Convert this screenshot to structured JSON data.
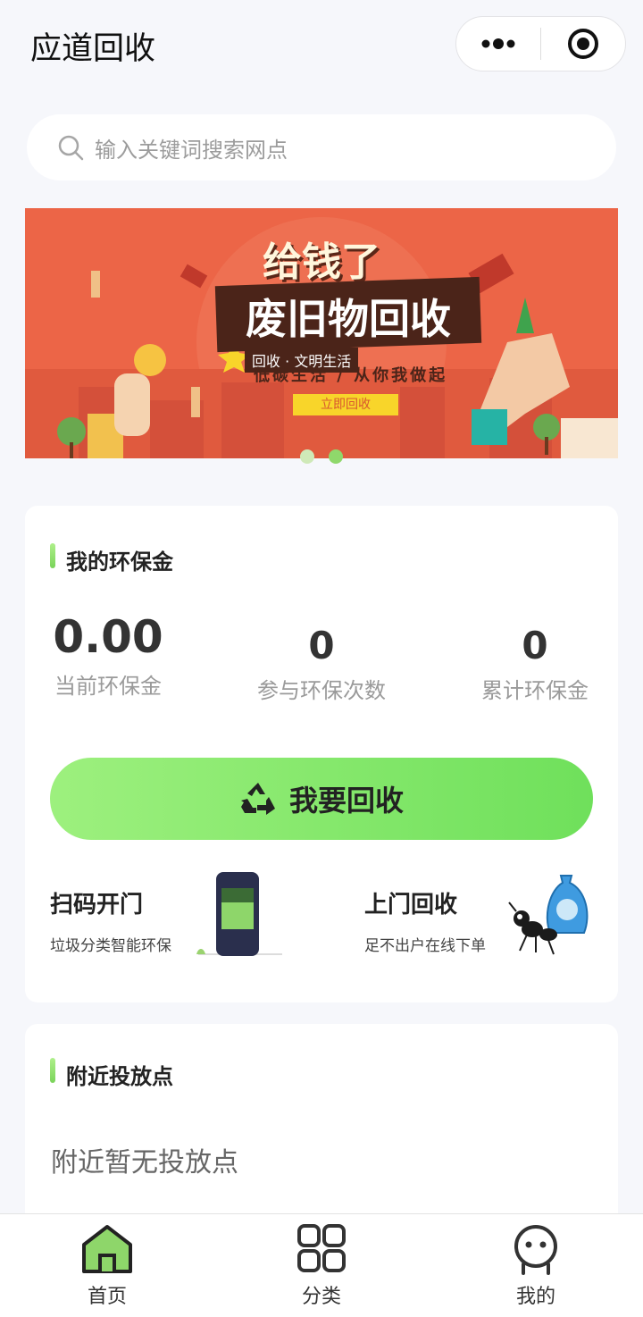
{
  "app": {
    "title": "应道回收"
  },
  "search": {
    "placeholder": "输入关键词搜索网点"
  },
  "banner": {
    "title_line1": "给钱了",
    "title_line2": "废旧物回收",
    "tag": "回收 · 文明生活",
    "subtitle": "低碳生活 / 从你我做起",
    "button": "立即回收",
    "slides": 2,
    "active_slide": 2
  },
  "wallet": {
    "title": "我的环保金",
    "stats": [
      {
        "value": "0.00",
        "label": "当前环保金"
      },
      {
        "value": "0",
        "label": "参与环保次数"
      },
      {
        "value": "0",
        "label": "累计环保金"
      }
    ],
    "recycle_button": "我要回收"
  },
  "services": [
    {
      "title": "扫码开门",
      "subtitle": "垃圾分类智能环保",
      "icon": "phone-scan-icon"
    },
    {
      "title": "上门回收",
      "subtitle": "足不出户在线下单",
      "icon": "ant-recycle-bag-icon"
    }
  ],
  "nearby": {
    "title": "附近投放点",
    "empty": "附近暂无投放点"
  },
  "tabbar": [
    {
      "label": "首页",
      "icon": "home-icon",
      "active": true
    },
    {
      "label": "分类",
      "icon": "grid-icon",
      "active": false
    },
    {
      "label": "我的",
      "icon": "user-icon",
      "active": false
    }
  ],
  "colors": {
    "accent": "#7ee06a",
    "banner": "#ec6547",
    "dot_active": "#8fd86b",
    "dot_inactive": "#cfe9b8"
  }
}
